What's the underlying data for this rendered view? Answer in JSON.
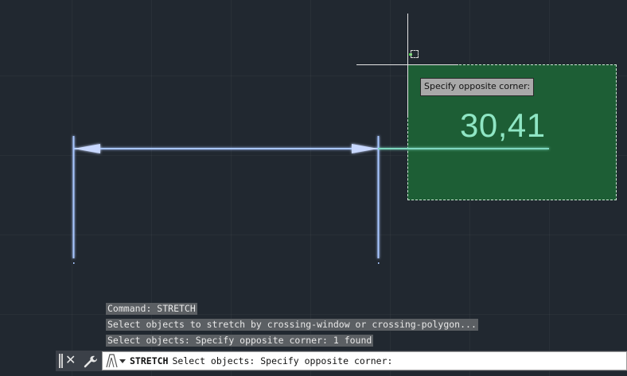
{
  "canvas": {
    "dimension_value": "30,41",
    "tooltip": "Specify opposite corner:",
    "selection_fill": "#1d5e35",
    "dimension_text_color": "#8fe6c4"
  },
  "command_history": [
    "Command: STRETCH",
    "Select objects to stretch by crossing-window or crossing-polygon...",
    "Select objects: Specify opposite corner: 1 found"
  ],
  "command_line": {
    "command_name": "STRETCH",
    "prompt": "Select objects: Specify opposite corner:",
    "close_icon": "close-icon",
    "customize_icon": "wrench-icon",
    "recent_icon": "recent-commands-icon"
  }
}
